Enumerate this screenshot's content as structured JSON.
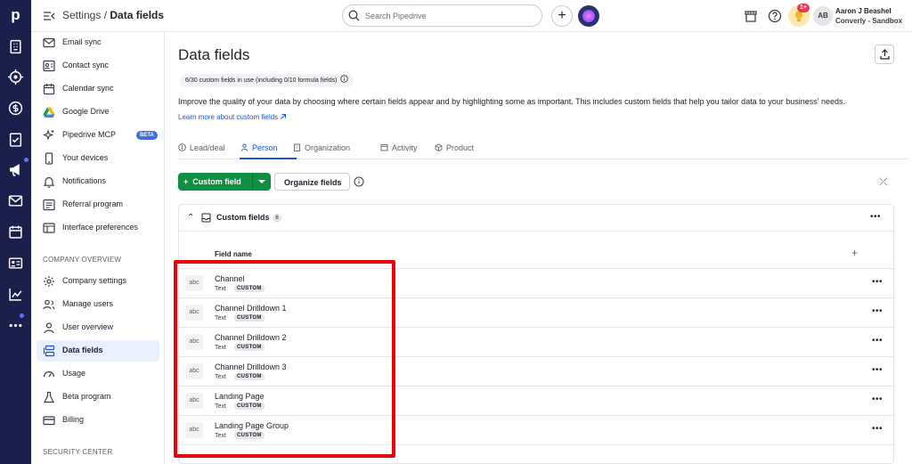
{
  "topbar": {
    "breadcrumb_parent": "Settings",
    "breadcrumb_sep": " / ",
    "breadcrumb_current": "Data fields",
    "search_placeholder": "Search Pipedrive",
    "notification_badge": "1+",
    "avatar_initials": "AB",
    "user_name": "Aaron J Beashel",
    "company": "Converly - Sandbox"
  },
  "rail": {
    "logo": "p",
    "icons": [
      "building-icon",
      "target-icon",
      "dollar-icon",
      "clipboard-check-icon",
      "megaphone-icon",
      "mail-icon",
      "calendar-icon",
      "contact-card-icon",
      "chart-icon",
      "more-icon"
    ]
  },
  "sidebar": {
    "items": [
      {
        "label": "Email sync",
        "icon": "mail-icon"
      },
      {
        "label": "Contact sync",
        "icon": "contact-sync-icon"
      },
      {
        "label": "Calendar sync",
        "icon": "calendar-icon"
      },
      {
        "label": "Google Drive",
        "icon": "google-drive-icon"
      },
      {
        "label": "Pipedrive MCP",
        "icon": "sparkle-icon",
        "badge": "BETA"
      },
      {
        "label": "Your devices",
        "icon": "phone-icon"
      },
      {
        "label": "Notifications",
        "icon": "bell-icon"
      },
      {
        "label": "Referral program",
        "icon": "referral-icon"
      },
      {
        "label": "Interface preferences",
        "icon": "interface-icon"
      }
    ],
    "company_header": "COMPANY OVERVIEW",
    "company_items": [
      {
        "label": "Company settings",
        "icon": "gear-icon"
      },
      {
        "label": "Manage users",
        "icon": "users-icon"
      },
      {
        "label": "User overview",
        "icon": "user-overview-icon"
      },
      {
        "label": "Data fields",
        "icon": "data-fields-icon",
        "active": true
      },
      {
        "label": "Usage",
        "icon": "gauge-icon"
      },
      {
        "label": "Beta program",
        "icon": "flask-icon"
      },
      {
        "label": "Billing",
        "icon": "card-icon"
      }
    ],
    "security_header": "SECURITY CENTER"
  },
  "main": {
    "title": "Data fields",
    "usage": "6/30 custom fields in use (including 0/10 formula fields)",
    "description": "Improve the quality of your data by choosing where certain fields appear and by highlighting some as important. This includes custom fields that help you tailor data to your business' needs.",
    "learn_more": "Learn more about custom fields",
    "tabs": [
      "Lead/deal",
      "Person",
      "Organization",
      "Activity",
      "Product"
    ],
    "active_tab": "Person",
    "custom_field_button": "Custom field",
    "organize_button": "Organize fields",
    "section_title": "Custom fields",
    "section_count": "6",
    "column_header": "Field name",
    "fields": [
      {
        "name": "Channel",
        "type": "Text",
        "tag": "CUSTOM",
        "icon_text": "abc"
      },
      {
        "name": "Channel Drilldown 1",
        "type": "Text",
        "tag": "CUSTOM",
        "icon_text": "abc"
      },
      {
        "name": "Channel Drilldown 2",
        "type": "Text",
        "tag": "CUSTOM",
        "icon_text": "abc"
      },
      {
        "name": "Channel Drilldown 3",
        "type": "Text",
        "tag": "CUSTOM",
        "icon_text": "abc"
      },
      {
        "name": "Landing Page",
        "type": "Text",
        "tag": "CUSTOM",
        "icon_text": "abc"
      },
      {
        "name": "Landing Page Group",
        "type": "Text",
        "tag": "CUSTOM",
        "icon_text": "abc"
      }
    ]
  },
  "colors": {
    "rail_bg": "#1b1f4b",
    "primary_green": "#0f8f41",
    "link_blue": "#1a56c9",
    "highlight_red": "#e8000b"
  }
}
